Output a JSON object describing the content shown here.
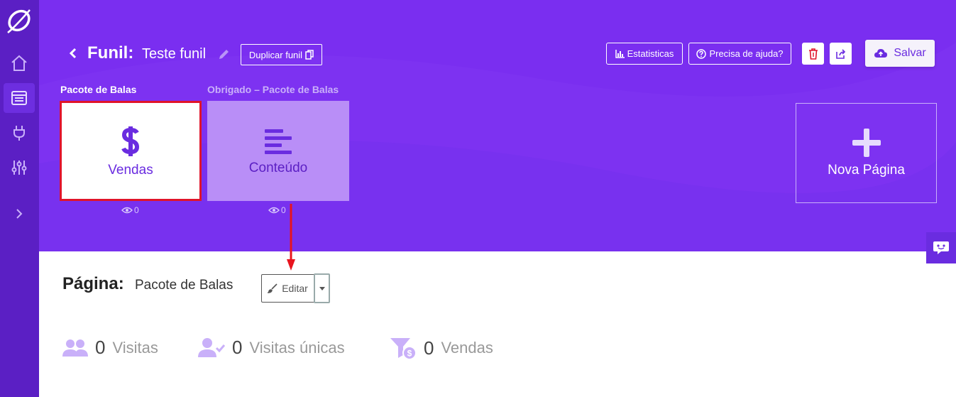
{
  "header": {
    "funnel_label": "Funil:",
    "funnel_name": "Teste funil",
    "duplicate_label": "Duplicar funil",
    "stats_label": "Estatisticas",
    "help_label": "Precisa de ajuda?",
    "save_label": "Salvar"
  },
  "pages": [
    {
      "title": "Pacote de Balas",
      "card_label": "Vendas",
      "views": "0",
      "icon": "dollar-icon"
    },
    {
      "title": "Obrigado – Pacote de Balas",
      "card_label": "Conteúdo",
      "views": "0",
      "icon": "text-lines-icon"
    }
  ],
  "new_page_label": "Nova Página",
  "current_page": {
    "label": "Página:",
    "name": "Pacote de Balas",
    "edit_label": "Editar"
  },
  "stats": [
    {
      "value": "0",
      "label": "Visitas",
      "icon": "users-icon"
    },
    {
      "value": "0",
      "label": "Visitas únicas",
      "icon": "user-check-icon"
    },
    {
      "value": "0",
      "label": "Vendas",
      "icon": "funnel-dollar-icon"
    }
  ],
  "sidebar": {
    "items": [
      "home-icon",
      "pages-icon",
      "plug-icon",
      "sliders-icon",
      "chevron-right-icon"
    ],
    "active": "pages-icon"
  },
  "colors": {
    "sidebar": "#5b1fc4",
    "header": "#7a2ef0",
    "accent": "#6a2ce0",
    "selected_border": "#e0142a",
    "annotation_arrow": "#e8141e"
  }
}
